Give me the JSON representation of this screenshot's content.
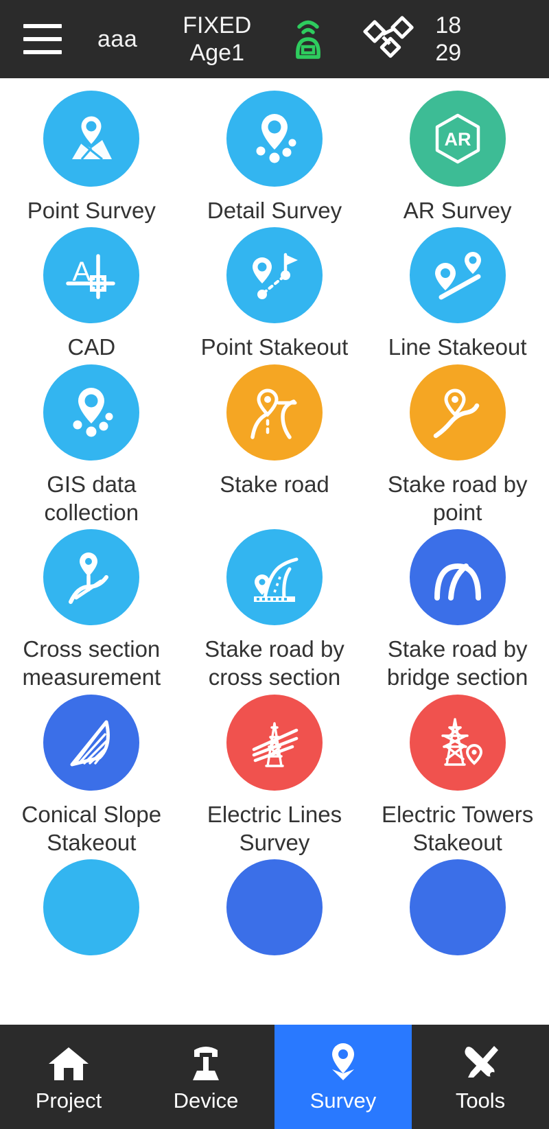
{
  "statusbar": {
    "menu_icon": "hamburger-menu-icon",
    "project_name": "aaa",
    "solution_status": "FIXED",
    "age_status": "Age1",
    "rover_icon": "rover-signal-icon",
    "satellite_icon": "satellite-icon",
    "satellites_used": "18",
    "satellites_tracked": "29"
  },
  "grid": {
    "items": [
      {
        "label": "Point Survey",
        "icon": "map-pin-icon",
        "color": "#33B5F0"
      },
      {
        "label": "Detail Survey",
        "icon": "pin-dots-icon",
        "color": "#33B5F0"
      },
      {
        "label": "AR Survey",
        "icon": "ar-hexagon-icon",
        "color": "#3DBC95"
      },
      {
        "label": "CAD",
        "icon": "cad-letter-a-icon",
        "color": "#33B5F0"
      },
      {
        "label": "Point Stakeout",
        "icon": "pin-flag-path-icon",
        "color": "#33B5F0"
      },
      {
        "label": "Line Stakeout",
        "icon": "two-pins-line-icon",
        "color": "#33B5F0"
      },
      {
        "label": "GIS data collection",
        "icon": "pin-dots-icon",
        "color": "#33B5F0"
      },
      {
        "label": "Stake road",
        "icon": "road-pin-icon",
        "color": "#F5A623"
      },
      {
        "label": "Stake road by point",
        "icon": "road-curve-pin-icon",
        "color": "#F5A623"
      },
      {
        "label": "Cross section measurement",
        "icon": "cross-section-pin-icon",
        "color": "#33B5F0"
      },
      {
        "label": "Stake road by cross section",
        "icon": "road-cross-section-icon",
        "color": "#33B5F0"
      },
      {
        "label": "Stake road by bridge section",
        "icon": "bridge-arch-icon",
        "color": "#3B6FE8"
      },
      {
        "label": "Conical Slope Stakeout",
        "icon": "conical-fan-icon",
        "color": "#3B6FE8"
      },
      {
        "label": "Electric Lines Survey",
        "icon": "electric-lines-icon",
        "color": "#F0524E"
      },
      {
        "label": "Electric Towers Stakeout",
        "icon": "electric-tower-pin-icon",
        "color": "#F0524E"
      },
      {
        "label": "",
        "icon": "partial-tile-icon",
        "color": "#33B5F0"
      },
      {
        "label": "",
        "icon": "partial-tile-icon",
        "color": "#3B6FE8"
      },
      {
        "label": "",
        "icon": "partial-tile-icon",
        "color": "#3B6FE8"
      }
    ]
  },
  "bottomnav": {
    "items": [
      {
        "label": "Project",
        "icon": "home-icon",
        "active": false
      },
      {
        "label": "Device",
        "icon": "instrument-icon",
        "active": false
      },
      {
        "label": "Survey",
        "icon": "location-pin-icon",
        "active": true
      },
      {
        "label": "Tools",
        "icon": "tools-icon",
        "active": false
      }
    ],
    "active_color": "#2979FF"
  }
}
